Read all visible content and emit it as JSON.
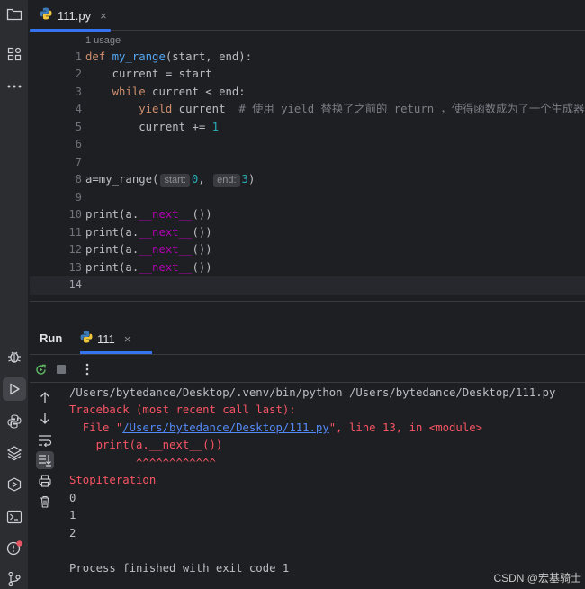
{
  "toolstrip": {
    "top": [
      "folder-icon",
      "structure-icon",
      "more-icon"
    ],
    "bottom": [
      "debug-icon",
      "run-icon",
      "python-console-icon",
      "layers-icon",
      "services-icon",
      "terminal-icon",
      "problems-icon",
      "git-icon"
    ]
  },
  "editor": {
    "tab": {
      "label": "111.py",
      "close": "×"
    },
    "usage": "1 usage",
    "line_numbers": [
      "1",
      "2",
      "3",
      "4",
      "5",
      "6",
      "7",
      "8",
      "9",
      "10",
      "11",
      "12",
      "13",
      "14"
    ],
    "current_line": "14",
    "code": {
      "l1": {
        "kw": "def",
        "fn": "my_range",
        "rest": "(start, end):"
      },
      "l2": "    current = start",
      "l3": {
        "indent": "    ",
        "kw": "while",
        "rest": " current < end:"
      },
      "l4": {
        "indent": "        ",
        "kw": "yield",
        "rest": " current  ",
        "comment": "# 使用 yield 替换了之前的 return ，使得函数成为了一个生成器"
      },
      "l5": {
        "pre": "        current += ",
        "num": "1"
      },
      "l8": {
        "pre": "a=my_range(",
        "hint1": "start:",
        "arg1": "0",
        "sep": ", ",
        "hint2": "end:",
        "arg2": "3",
        "post": ")"
      },
      "print_pre": "print(a.",
      "print_dunder": "__next__",
      "print_post": "())"
    }
  },
  "run": {
    "title": "Run",
    "tab": {
      "label": "111",
      "close": "×"
    },
    "toolbar": [
      "rerun-icon",
      "stop-icon",
      "more-vertical-icon"
    ],
    "side_tools": [
      "up-arrow-icon",
      "down-arrow-icon",
      "soft-wrap-icon",
      "scroll-to-end-icon",
      "print-icon",
      "trash-icon"
    ],
    "console": {
      "l1": "/Users/bytedance/Desktop/.venv/bin/python /Users/bytedance/Desktop/111.py",
      "l2": "Traceback (most recent call last):",
      "l3_pre": "  File \"",
      "l3_link": "/Users/bytedance/Desktop/111.py",
      "l3_post": "\", line 13, in <module>",
      "l4": "    print(a.__next__())",
      "l5": "          ^^^^^^^^^^^^",
      "l6": "StopIteration",
      "l7": "0",
      "l8": "1",
      "l9": "2",
      "l10": "Process finished with exit code 1"
    }
  },
  "watermark": "CSDN @宏基骑士"
}
